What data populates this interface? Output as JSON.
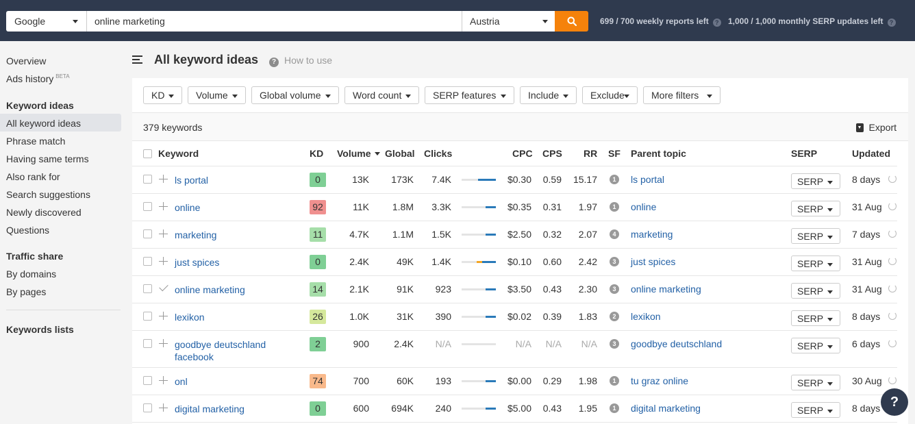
{
  "topbar": {
    "engine": "Google",
    "query": "online marketing",
    "country": "Austria",
    "weekly_quota": "699 / 700 weekly reports left",
    "monthly_quota": "1,000 / 1,000 monthly SERP updates left",
    "accent": "#f5820b"
  },
  "sidebar": {
    "overview": "Overview",
    "ads_history": "Ads history",
    "ads_badge": "BETA",
    "keyword_ideas_head": "Keyword ideas",
    "items": [
      "All keyword ideas",
      "Phrase match",
      "Having same terms",
      "Also rank for",
      "Search suggestions",
      "Newly discovered",
      "Questions"
    ],
    "traffic_head": "Traffic share",
    "traffic_items": [
      "By domains",
      "By pages"
    ],
    "lists_head": "Keywords lists"
  },
  "main": {
    "title": "All keyword ideas",
    "howto": "How to use",
    "filters": [
      "KD",
      "Volume",
      "Global volume",
      "Word count",
      "SERP features",
      "Include",
      "Exclude",
      "More filters"
    ],
    "count": "379 keywords",
    "export": "Export"
  },
  "table": {
    "headers": {
      "keyword": "Keyword",
      "kd": "KD",
      "volume": "Volume",
      "global": "Global",
      "clicks": "Clicks",
      "cpc": "CPC",
      "cps": "CPS",
      "rr": "RR",
      "sf": "SF",
      "parent": "Parent topic",
      "serp": "SERP",
      "updated": "Updated"
    },
    "serp_label": "SERP",
    "rows": [
      {
        "kw": "ls portal",
        "kd": "0",
        "kd_color": "#7fcf95",
        "vol": "13K",
        "global": "173K",
        "clicks": "7.4K",
        "cpc": "$0.30",
        "cps": "0.59",
        "rr": "15.17",
        "sf": "1",
        "parent": "ls portal",
        "upd": "8 days",
        "added": false,
        "paid": 0.0,
        "organic": 0.52
      },
      {
        "kw": "online",
        "kd": "92",
        "kd_color": "#f0908f",
        "vol": "11K",
        "global": "1.8M",
        "clicks": "3.3K",
        "cpc": "$0.35",
        "cps": "0.31",
        "rr": "1.97",
        "sf": "1",
        "parent": "online",
        "upd": "31 Aug",
        "added": false,
        "paid": 0.0,
        "organic": 0.3
      },
      {
        "kw": "marketing",
        "kd": "11",
        "kd_color": "#a6dea9",
        "vol": "4.7K",
        "global": "1.1M",
        "clicks": "1.5K",
        "cpc": "$2.50",
        "cps": "0.32",
        "rr": "2.07",
        "sf": "4",
        "parent": "marketing",
        "upd": "7 days",
        "added": false,
        "paid": 0.0,
        "organic": 0.3
      },
      {
        "kw": "just spices",
        "kd": "0",
        "kd_color": "#7fcf95",
        "vol": "2.4K",
        "global": "49K",
        "clicks": "1.4K",
        "cpc": "$0.10",
        "cps": "0.60",
        "rr": "2.42",
        "sf": "3",
        "parent": "just spices",
        "upd": "31 Aug",
        "added": false,
        "paid": 0.16,
        "organic": 0.4
      },
      {
        "kw": "online marketing",
        "kd": "14",
        "kd_color": "#a6dea9",
        "vol": "2.1K",
        "global": "91K",
        "clicks": "923",
        "cpc": "$3.50",
        "cps": "0.43",
        "rr": "2.30",
        "sf": "3",
        "parent": "online marketing",
        "upd": "31 Aug",
        "added": true,
        "paid": 0.0,
        "organic": 0.3
      },
      {
        "kw": "lexikon",
        "kd": "26",
        "kd_color": "#d5e89c",
        "vol": "1.0K",
        "global": "31K",
        "clicks": "390",
        "cpc": "$0.02",
        "cps": "0.39",
        "rr": "1.83",
        "sf": "2",
        "parent": "lexikon",
        "upd": "8 days",
        "added": false,
        "paid": 0.0,
        "organic": 0.3
      },
      {
        "kw": "goodbye deutschland facebook",
        "kd": "2",
        "kd_color": "#7fcf95",
        "vol": "900",
        "global": "2.4K",
        "clicks": "N/A",
        "cpc": "N/A",
        "cps": "N/A",
        "rr": "N/A",
        "sf": "3",
        "parent": "goodbye deutschland",
        "upd": "6 days",
        "added": false,
        "paid": 0.0,
        "organic": 0.0
      },
      {
        "kw": "onl",
        "kd": "74",
        "kd_color": "#f9b98b",
        "vol": "700",
        "global": "60K",
        "clicks": "193",
        "cpc": "$0.00",
        "cps": "0.29",
        "rr": "1.98",
        "sf": "1",
        "parent": "tu graz online",
        "upd": "30 Aug",
        "added": false,
        "paid": 0.0,
        "organic": 0.3
      },
      {
        "kw": "digital marketing",
        "kd": "0",
        "kd_color": "#7fcf95",
        "vol": "600",
        "global": "694K",
        "clicks": "240",
        "cpc": "$5.00",
        "cps": "0.43",
        "rr": "1.95",
        "sf": "1",
        "parent": "digital marketing",
        "upd": "8 days",
        "added": false,
        "paid": 0.0,
        "organic": 0.3
      }
    ]
  },
  "help_fab": "?"
}
